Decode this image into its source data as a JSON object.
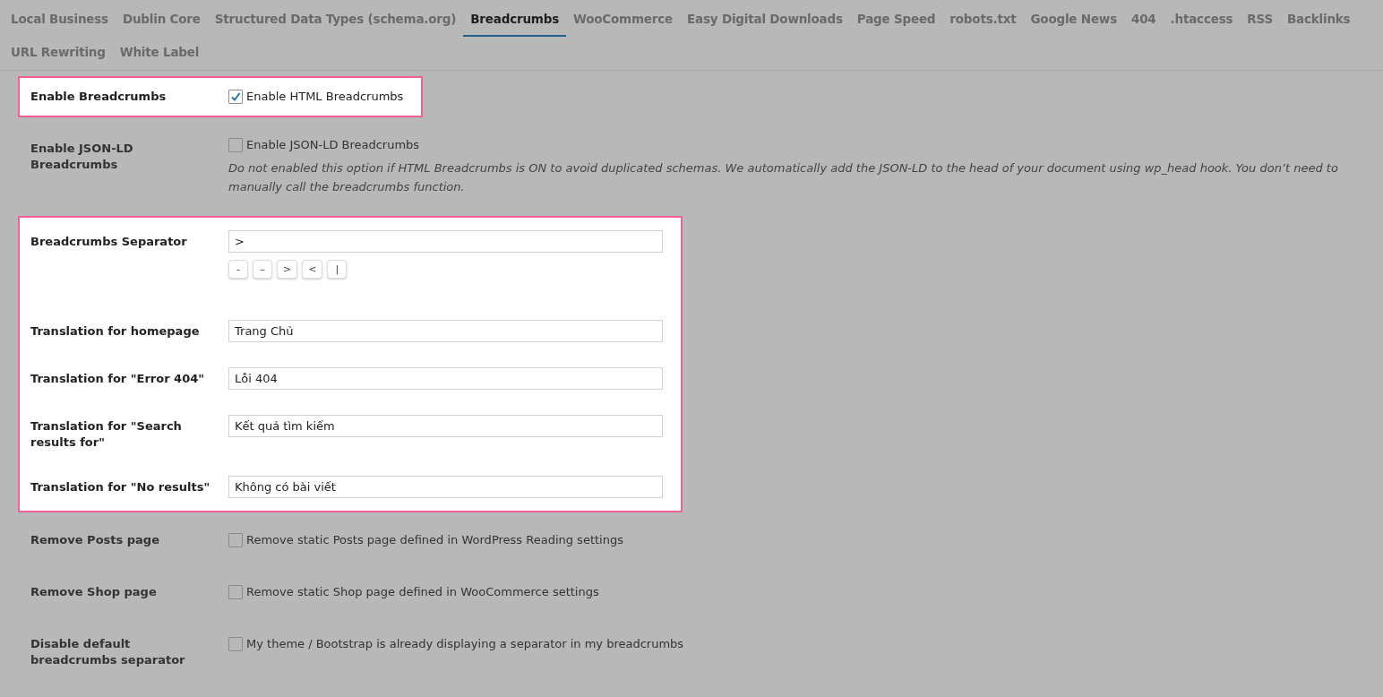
{
  "tabs": [
    {
      "label": "Local Business",
      "selected": false
    },
    {
      "label": "Dublin Core",
      "selected": false
    },
    {
      "label": "Structured Data Types (schema.org)",
      "selected": false
    },
    {
      "label": "Breadcrumbs",
      "selected": true
    },
    {
      "label": "WooCommerce",
      "selected": false
    },
    {
      "label": "Easy Digital Downloads",
      "selected": false
    },
    {
      "label": "Page Speed",
      "selected": false
    },
    {
      "label": "robots.txt",
      "selected": false
    },
    {
      "label": "Google News",
      "selected": false
    },
    {
      "label": "404",
      "selected": false
    },
    {
      "label": ".htaccess",
      "selected": false
    },
    {
      "label": "RSS",
      "selected": false
    },
    {
      "label": "Backlinks",
      "selected": false
    },
    {
      "label": "URL Rewriting",
      "selected": false
    },
    {
      "label": "White Label",
      "selected": false
    }
  ],
  "sections": [
    {
      "highlighted": true,
      "rows": [
        {
          "kind": "checkbox",
          "label": "Enable Breadcrumbs",
          "checkbox_label": "Enable HTML Breadcrumbs",
          "checked": true
        }
      ]
    },
    {
      "highlighted": false,
      "rows": [
        {
          "kind": "checkbox",
          "label": "Enable JSON-LD Breadcrumbs",
          "checkbox_label": "Enable JSON-LD Breadcrumbs",
          "checked": false,
          "description": "Do not enabled this option if HTML Breadcrumbs is ON to avoid duplicated schemas. We automatically add the JSON-LD to the head of your document using wp_head hook. You don’t need to manually call the breadcrumbs function."
        }
      ]
    },
    {
      "highlighted": true,
      "rows": [
        {
          "kind": "text",
          "label": "Breadcrumbs Separator",
          "value": ">",
          "buttons": [
            "-",
            "–",
            ">",
            "<",
            "|"
          ]
        },
        {
          "kind": "text",
          "label": "Translation for homepage",
          "value": "Trang Chủ"
        },
        {
          "kind": "text",
          "label": "Translation for \"Error 404\"",
          "value": "Lỗi 404"
        },
        {
          "kind": "text",
          "label": "Translation for \"Search results for\"",
          "value": "Kết quả tìm kiếm"
        },
        {
          "kind": "text",
          "label": "Translation for \"No results\"",
          "value": "Không có bài viết"
        }
      ]
    },
    {
      "highlighted": false,
      "rows": [
        {
          "kind": "checkbox",
          "label": "Remove Posts page",
          "checkbox_label": "Remove static Posts page defined in WordPress Reading settings",
          "checked": false
        },
        {
          "kind": "checkbox",
          "label": "Remove Shop page",
          "checkbox_label": "Remove static Shop page defined in WooCommerce settings",
          "checked": false
        },
        {
          "kind": "checkbox",
          "label": "Disable default breadcrumbs separator",
          "checkbox_label": "My theme / Bootstrap is already displaying a separator in my breadcrumbs",
          "checked": false
        }
      ]
    }
  ]
}
